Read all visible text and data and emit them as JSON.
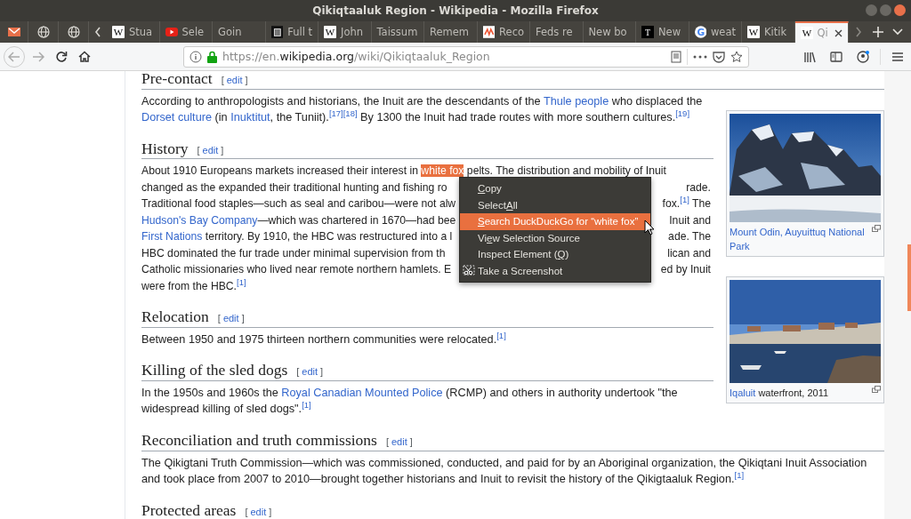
{
  "window": {
    "title": "Qikiqtaaluk Region - Wikipedia - Mozilla Firefox"
  },
  "pinned_tabs": [
    {
      "kind": "mail",
      "selected": false
    },
    {
      "kind": "globe",
      "selected": false
    },
    {
      "kind": "globe",
      "selected": false
    }
  ],
  "tabs": [
    {
      "label": "Stua",
      "kind": "letter-light",
      "icon_text": "W",
      "selected": false
    },
    {
      "label": "Sele",
      "kind": "video",
      "selected": false
    },
    {
      "label": "Goin",
      "kind": "plain",
      "selected": false
    },
    {
      "label": "Full t",
      "kind": "trash",
      "selected": false
    },
    {
      "label": "John",
      "kind": "letter-light",
      "icon_text": "W",
      "selected": false
    },
    {
      "label": "Taissum",
      "kind": "plain",
      "selected": false
    },
    {
      "label": "Remem",
      "kind": "plain",
      "selected": false
    },
    {
      "label": "Reco",
      "kind": "news",
      "selected": false
    },
    {
      "label": "Feds re",
      "kind": "plain",
      "selected": false
    },
    {
      "label": "New bo",
      "kind": "plain",
      "selected": false
    },
    {
      "label": "New",
      "kind": "letter-dark",
      "icon_text": "T",
      "selected": false
    },
    {
      "label": "weat",
      "kind": "letter-google",
      "icon_text": "G",
      "selected": false
    },
    {
      "label": "Kitik",
      "kind": "letter-light",
      "icon_text": "W",
      "selected": false
    },
    {
      "label": "Qi",
      "kind": "letter-light",
      "icon_text": "W",
      "selected": true
    }
  ],
  "address_bar": {
    "prefix": "https://en.",
    "domain": "wikipedia.org",
    "path": "/wiki/Qikiqtaaluk_Region"
  },
  "article": [
    {
      "kind": "heading",
      "title": "Pre-contact",
      "open": "[",
      "edit": "edit",
      "close": "]"
    },
    {
      "kind": "paragraph",
      "segments": [
        {
          "kind": "text",
          "t": "According to anthropologists and historians, the Inuit are the descendants of the "
        },
        {
          "kind": "link",
          "t": "Thule people"
        },
        {
          "kind": "text",
          "t": " who displaced the "
        },
        {
          "kind": "link",
          "t": "Dorset culture"
        },
        {
          "kind": "text",
          "t": " (in "
        },
        {
          "kind": "link",
          "t": "Inuktitut"
        },
        {
          "kind": "text",
          "t": ", the Tuniit)."
        },
        {
          "kind": "cite",
          "t": "[17]"
        },
        {
          "kind": "cite",
          "t": "[18]"
        },
        {
          "kind": "text",
          "t": " By 1300 the Inuit had trade routes with more southern cultures."
        },
        {
          "kind": "cite",
          "t": "[19]"
        }
      ]
    },
    {
      "kind": "heading",
      "title": "History",
      "open": "[",
      "edit": "edit",
      "close": "]"
    },
    {
      "kind": "covered",
      "lines": [
        {
          "left": [
            {
              "kind": "text",
              "t": "About 1910 Europeans markets increased their interest in "
            },
            {
              "kind": "highlight",
              "t": "white fox"
            },
            {
              "kind": "text",
              "t": " pelts. The distribution and mobility of Inuit"
            }
          ]
        },
        {
          "left": [
            {
              "kind": "text",
              "t": "changed as the expanded their traditional hunting and fishing ro"
            }
          ],
          "right": [
            {
              "kind": "text",
              "t": "rade."
            }
          ]
        },
        {
          "left": [
            {
              "kind": "text",
              "t": "Traditional food staples—such as seal and caribou—were not alw"
            }
          ],
          "right": [
            {
              "kind": "text",
              "t": "fox."
            },
            {
              "kind": "cite",
              "t": "[1]"
            },
            {
              "kind": "text",
              "t": " The"
            }
          ]
        },
        {
          "left": [
            {
              "kind": "link",
              "t": "Hudson's Bay Company"
            },
            {
              "kind": "text",
              "t": "—which was chartered in 1670—had bee"
            }
          ],
          "right": [
            {
              "kind": "text",
              "t": "Inuit and"
            }
          ]
        },
        {
          "left": [
            {
              "kind": "link",
              "t": "First Nations"
            },
            {
              "kind": "text",
              "t": " territory. By 1910, the HBC was restructured into a l"
            }
          ],
          "right": [
            {
              "kind": "text",
              "t": "ade. The"
            }
          ]
        },
        {
          "left": [
            {
              "kind": "text",
              "t": "HBC dominated the fur trade under minimal supervision from th"
            }
          ],
          "right": [
            {
              "kind": "text",
              "t": "lican and"
            }
          ]
        },
        {
          "left": [
            {
              "kind": "text",
              "t": "Catholic missionaries who lived near remote northern hamlets. E"
            }
          ],
          "right": [
            {
              "kind": "text",
              "t": "ed by Inuit"
            }
          ]
        },
        {
          "left": [
            {
              "kind": "text",
              "t": "were from the HBC."
            },
            {
              "kind": "cite",
              "t": "[1]"
            }
          ]
        }
      ]
    },
    {
      "kind": "heading",
      "title": "Relocation",
      "open": "[",
      "edit": "edit",
      "close": "]"
    },
    {
      "kind": "paragraph",
      "segments": [
        {
          "kind": "text",
          "t": "Between 1950 and 1975 thirteen northern communities were relocated."
        },
        {
          "kind": "cite",
          "t": "[1]"
        }
      ]
    },
    {
      "kind": "heading",
      "title": "Killing of the sled dogs",
      "open": "[",
      "edit": "edit",
      "close": "]"
    },
    {
      "kind": "paragraph",
      "segments": [
        {
          "kind": "text",
          "t": "In the 1950s and 1960s the "
        },
        {
          "kind": "link",
          "t": "Royal Canadian Mounted Police"
        },
        {
          "kind": "text",
          "t": " (RCMP) and others in authority undertook \"the widespread killing of sled dogs\"."
        },
        {
          "kind": "cite",
          "t": "[1]"
        }
      ]
    },
    {
      "kind": "heading",
      "title": "Reconciliation and truth commissions",
      "open": "[",
      "edit": "edit",
      "close": "]"
    },
    {
      "kind": "paragraph",
      "segments": [
        {
          "kind": "text",
          "t": "The Qikigtani Truth Commission—which was commissioned, conducted, and paid for by an Aboriginal organization, the Qikiqtani Inuit Association and took place from 2007 to 2010—brought together historians and Inuit to revisit the history of the Qikigtaaluk Region."
        },
        {
          "kind": "cite",
          "t": "[1]"
        }
      ]
    },
    {
      "kind": "heading",
      "title": "Protected areas",
      "open": "[",
      "edit": "edit",
      "close": "]"
    }
  ],
  "figures": [
    {
      "kind": "mountain",
      "caption": [
        {
          "kind": "link",
          "t": "Mount Odin, Auyuittuq National Park"
        }
      ]
    },
    {
      "kind": "harbour",
      "caption": [
        {
          "kind": "link",
          "t": "Iqaluit"
        },
        {
          "kind": "text",
          "t": " waterfront, 2011"
        }
      ]
    }
  ],
  "context_menu": [
    {
      "kind": "item",
      "parts": [
        {
          "kind": "key",
          "t": "C"
        },
        {
          "kind": "plain",
          "t": "opy"
        }
      ],
      "selected": false
    },
    {
      "kind": "item",
      "parts": [
        {
          "kind": "plain",
          "t": "Select "
        },
        {
          "kind": "key",
          "t": "A"
        },
        {
          "kind": "plain",
          "t": "ll"
        }
      ],
      "selected": false
    },
    {
      "kind": "item",
      "parts": [
        {
          "kind": "key",
          "t": "S"
        },
        {
          "kind": "plain",
          "t": "earch DuckDuckGo for “white fox”"
        }
      ],
      "selected": true
    },
    {
      "kind": "item",
      "parts": [
        {
          "kind": "plain",
          "t": "Vi"
        },
        {
          "kind": "key",
          "t": "e"
        },
        {
          "kind": "plain",
          "t": "w Selection Source"
        }
      ],
      "selected": false
    },
    {
      "kind": "item",
      "parts": [
        {
          "kind": "plain",
          "t": "Inspect Element ("
        },
        {
          "kind": "key",
          "t": "Q"
        },
        {
          "kind": "plain",
          "t": ")"
        }
      ],
      "selected": false
    },
    {
      "kind": "screenshot",
      "parts": [
        {
          "kind": "plain",
          "t": "Take a Screenshot"
        }
      ],
      "selected": false
    }
  ]
}
